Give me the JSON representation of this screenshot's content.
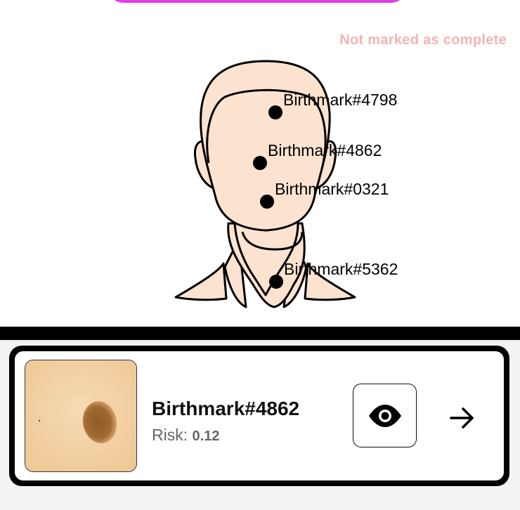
{
  "header": {
    "status_text": "Not marked as complete"
  },
  "body_map": {
    "region": "head-and-neck",
    "skin_color": "#fbe3d0",
    "birthmarks": [
      {
        "label": "Birthmark#4798"
      },
      {
        "label": "Birthmark#4862"
      },
      {
        "label": "Birthmark#0321"
      },
      {
        "label": "Birthmark#5362"
      }
    ]
  },
  "selected_card": {
    "title": "Birthmark#4862",
    "risk_label": "Risk:",
    "risk_value": "0.12",
    "view_icon": "eye-icon",
    "next_icon": "arrow-right-icon"
  },
  "colors": {
    "accent_button": "#e23ee6",
    "status_text": "#f4b4b4",
    "risk_text": "#666666"
  }
}
